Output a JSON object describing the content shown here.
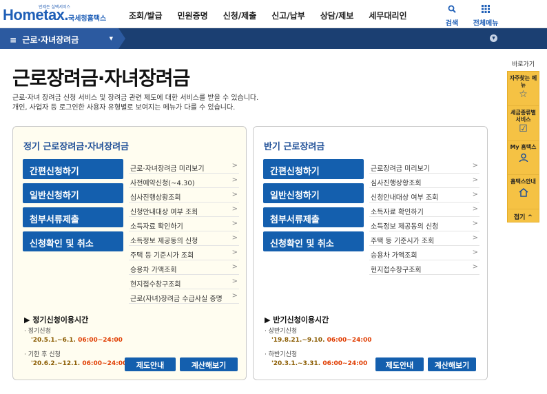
{
  "header": {
    "logo_sub": "언제든 실택서비스",
    "logo_main": "Hometax.",
    "logo_kr": "국세청홈택스",
    "menu": [
      "조회/발급",
      "민원증명",
      "신청/제출",
      "신고/납부",
      "상담/제보",
      "세무대리인"
    ],
    "search_label": "검색",
    "allmenu_label": "전체메뉴"
  },
  "navbar": {
    "current": "근로·자녀장려금"
  },
  "page": {
    "title": "근로장려금·자녀장려금",
    "desc1": "근로·자녀 장려금 신청 서비스 및 장려금 관련 제도에 대한 서비스를 받을 수 있습니다.",
    "desc2": "개인, 사업자 등 로그인한 사용자 유형별로 보여지는 메뉴가 다를 수 있습니다."
  },
  "left_panel": {
    "title": "정기 근로장려금·자녀장려금",
    "buttons": [
      "간편신청하기",
      "일반신청하기",
      "첨부서류제출",
      "신청확인 및 취소"
    ],
    "links": [
      "근로·자녀장려금 미리보기",
      "사전예약신청(~4.30)",
      "심사진행상황조회",
      "신청안내대상 여부 조회",
      "소득자료 확인하기",
      "소득정보 제공동의 신청",
      "주택 등 기준시가 조회",
      "승용차 가액조회",
      "현지접수창구조회",
      "근로(자녀)장려금 수급사실 증명"
    ],
    "time_title": "정기신청이용시간",
    "time1_label": "정기신청",
    "time1_date": "'20.5.1.~6.1.",
    "time1_hours": "06:00~24:00",
    "time2_label": "기한 후 신청",
    "time2_date": "'20.6.2.~12.1.",
    "time2_hours": "06:00~24:00",
    "btn_guide": "제도안내",
    "btn_calc": "계산해보기"
  },
  "right_panel": {
    "title": "반기 근로장려금",
    "buttons": [
      "간편신청하기",
      "일반신청하기",
      "첨부서류제출",
      "신청확인 및 취소"
    ],
    "links": [
      "근로장려금 미리보기",
      "심사진행상황조회",
      "신청안내대상 여부 조회",
      "소득자료 확인하기",
      "소득정보 제공동의 신청",
      "주택 등 기준시가 조회",
      "승용차 가액조회",
      "현지접수창구조회"
    ],
    "time_title": "반기신청이용시간",
    "time1_label": "상반기신청",
    "time1_date": "'19.8.21.~9.10.",
    "time1_hours": "06:00~24:00",
    "time2_label": "하반기신청",
    "time2_date": "'20.3.1.~3.31.",
    "time2_hours": "06:00~24:00",
    "btn_guide": "제도안내",
    "btn_calc": "계산해보기"
  },
  "quick": {
    "title": "바로가기",
    "items": [
      "자주찾는 메뉴",
      "세금종류별 서비스",
      "My 홈택스",
      "홈택스안내"
    ],
    "close": "접기 ^"
  }
}
